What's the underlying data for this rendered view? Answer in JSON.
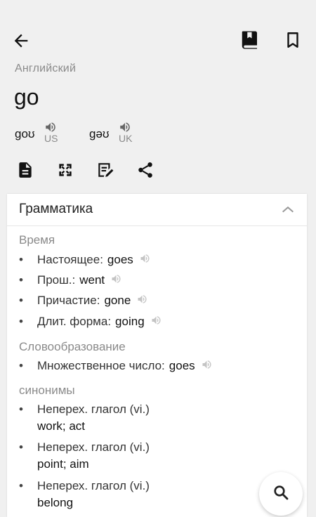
{
  "header": {
    "language": "Английский",
    "word": "go",
    "pronunciations": [
      {
        "ipa": "goʊ",
        "region": "US"
      },
      {
        "ipa": "gəʊ",
        "region": "UK"
      }
    ],
    "icons": {
      "back": "arrow-left-icon",
      "book": "book-icon",
      "bookmark": "bookmark-icon",
      "tools": [
        "document-icon",
        "fullscreen-icon",
        "edit-note-icon",
        "share-icon"
      ]
    }
  },
  "grammar": {
    "title": "Грамматика",
    "sections": {
      "tense_label": "Время",
      "tense_items": [
        {
          "label": "Настоящее:",
          "value": "goes"
        },
        {
          "label": "Прош.:",
          "value": "went"
        },
        {
          "label": "Причастие:",
          "value": "gone"
        },
        {
          "label": "Длит. форма:",
          "value": "going"
        }
      ],
      "wordform_label": "Словообразование",
      "wordform_items": [
        {
          "label": "Множественное число:",
          "value": "goes"
        }
      ],
      "synonyms_label": "синонимы",
      "synonyms": [
        {
          "pos": "Неперех. глагол (vi.)",
          "words": "work; act"
        },
        {
          "pos": "Неперех. глагол (vi.)",
          "words": "point; aim"
        },
        {
          "pos": "Неперех. глагол (vi.)",
          "words": "belong"
        }
      ],
      "bullet": "•"
    }
  },
  "colors": {
    "background": "#f0f0f0",
    "card": "#ffffff",
    "muted": "#8a8a8a",
    "text": "#111111"
  }
}
